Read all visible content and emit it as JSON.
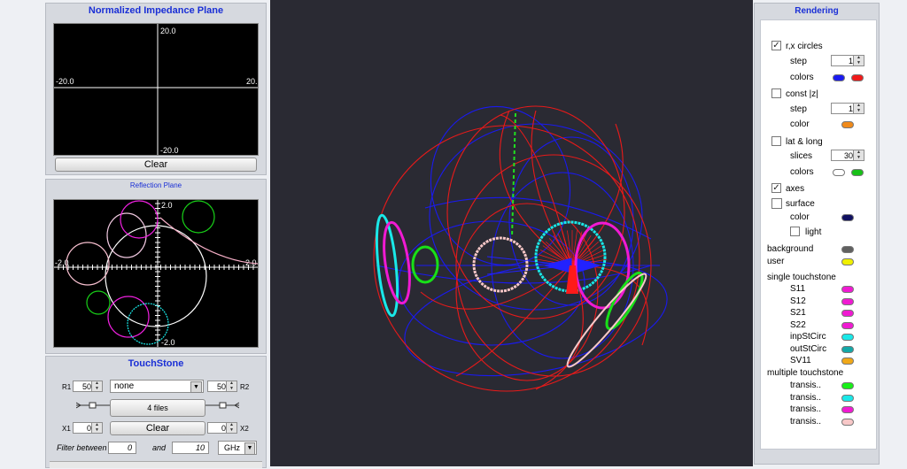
{
  "impedance_panel": {
    "title": "Normalized Impedance Plane",
    "axis_top": "20.0",
    "axis_left": "-20.0",
    "axis_right": "20.",
    "axis_bottom": "-20.0",
    "clear_label": "Clear"
  },
  "reflection_panel": {
    "title": "Reflection Plane",
    "axis_top": "2.0",
    "axis_left": "-2.0",
    "axis_right": "2.0",
    "axis_bottom": "-2.0"
  },
  "touchstone": {
    "title": "TouchStone",
    "r1_label": "R1",
    "r1_value": "50",
    "source_select": "none",
    "r2_value": "50",
    "r2_label": "R2",
    "files_label": "4 files",
    "x1_label": "X1",
    "x1_value": "0",
    "clear_label": "Clear",
    "x2_value": "0",
    "x2_label": "X2",
    "filter_label": "Filter between",
    "filter_from": "0",
    "and_label": "and",
    "filter_to": "10",
    "unit_select": "GHz"
  },
  "rendering": {
    "title": "Rendering",
    "rx_circles": "r,x circles",
    "step_label": "step",
    "rx_step": "1",
    "colors_label": "colors",
    "const_z": "const |z|",
    "constz_step": "1",
    "color_label": "color",
    "lat_long": "lat & long",
    "slices_label": "slices",
    "slices_value": "30",
    "axes": "axes",
    "surface": "surface",
    "light": "light",
    "background": "background",
    "user": "user",
    "single_touchstone": "single touchstone",
    "single_items": [
      "S11",
      "S12",
      "S21",
      "S22",
      "inpStCirc",
      "outStCirc",
      "SV11"
    ],
    "multiple_touchstone": "multiple touchstone",
    "multiple_items": [
      "transis..",
      "transis..",
      "transis..",
      "transis.."
    ],
    "check_glyph": "✓"
  },
  "colors": {
    "rx_color_1": "#1a1af0",
    "rx_color_2": "#f01a1a",
    "constz_color": "#f08a1a",
    "latlong_color_1": "#ffffff",
    "latlong_color_2": "#18c018",
    "surface_color": "#101060",
    "background_color": "#606060",
    "user_color": "#f0f000",
    "single_colors": [
      "#f01ad2",
      "#f01ad2",
      "#f01ad2",
      "#f01ad2",
      "#1ae8e8",
      "#14a8a8",
      "#f0a818"
    ],
    "multiple_colors": [
      "#18f018",
      "#1ae8e8",
      "#f01ad2",
      "#f8c8c8"
    ],
    "viewport_bg": "#2a2a33"
  }
}
